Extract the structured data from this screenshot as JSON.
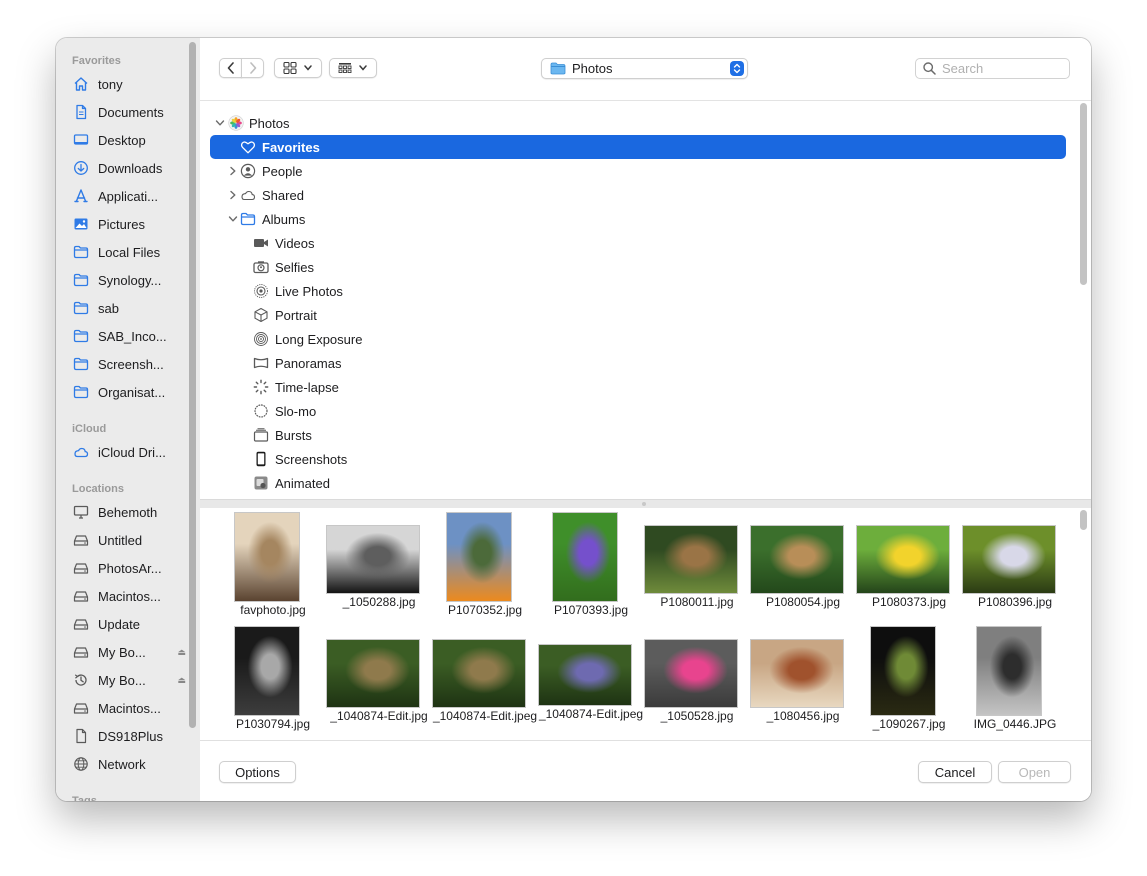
{
  "sidebar": {
    "sections": [
      {
        "title": "Favorites",
        "items": [
          {
            "label": "tony",
            "icon": "home-icon"
          },
          {
            "label": "Documents",
            "icon": "document-icon"
          },
          {
            "label": "Desktop",
            "icon": "desktop-icon"
          },
          {
            "label": "Downloads",
            "icon": "download-icon"
          },
          {
            "label": "Applicati...",
            "icon": "applications-icon"
          },
          {
            "label": "Pictures",
            "icon": "pictures-icon"
          },
          {
            "label": "Local Files",
            "icon": "folder-icon"
          },
          {
            "label": "Synology...",
            "icon": "folder-icon"
          },
          {
            "label": "sab",
            "icon": "folder-icon"
          },
          {
            "label": "SAB_Inco...",
            "icon": "folder-icon"
          },
          {
            "label": "Screensh...",
            "icon": "folder-icon"
          },
          {
            "label": "Organisat...",
            "icon": "folder-icon"
          }
        ]
      },
      {
        "title": "iCloud",
        "items": [
          {
            "label": "iCloud Dri...",
            "icon": "icloud-icon"
          }
        ]
      },
      {
        "title": "Locations",
        "items": [
          {
            "label": "Behemoth",
            "icon": "computer-icon"
          },
          {
            "label": "Untitled",
            "icon": "drive-icon"
          },
          {
            "label": "PhotosAr...",
            "icon": "drive-icon"
          },
          {
            "label": "Macintos...",
            "icon": "drive-icon"
          },
          {
            "label": "Update",
            "icon": "drive-icon"
          },
          {
            "label": "My Bo...",
            "icon": "drive-icon",
            "eject": "⏏"
          },
          {
            "label": "My Bo...",
            "icon": "time-machine-icon",
            "eject": "⏏"
          },
          {
            "label": "Macintos...",
            "icon": "drive-icon"
          },
          {
            "label": "DS918Plus",
            "icon": "server-icon"
          },
          {
            "label": "Network",
            "icon": "network-icon"
          }
        ]
      },
      {
        "title": "Tags",
        "items": []
      }
    ]
  },
  "toolbar": {
    "location": "Photos",
    "search_placeholder": "Search"
  },
  "tree": [
    {
      "label": "Photos",
      "level": 0,
      "disclosure": "open",
      "icon": "photos-app-icon"
    },
    {
      "label": "Favorites",
      "level": 1,
      "disclosure": "none",
      "icon": "heart-icon",
      "selected": true
    },
    {
      "label": "People",
      "level": 1,
      "disclosure": "closed",
      "icon": "person-icon"
    },
    {
      "label": "Shared",
      "level": 1,
      "disclosure": "closed",
      "icon": "cloud-icon"
    },
    {
      "label": "Albums",
      "level": 1,
      "disclosure": "open",
      "icon": "folder-icon"
    },
    {
      "label": "Videos",
      "level": 2,
      "disclosure": "none",
      "icon": "video-icon"
    },
    {
      "label": "Selfies",
      "level": 2,
      "disclosure": "none",
      "icon": "selfie-camera-icon"
    },
    {
      "label": "Live Photos",
      "level": 2,
      "disclosure": "none",
      "icon": "live-photo-icon"
    },
    {
      "label": "Portrait",
      "level": 2,
      "disclosure": "none",
      "icon": "cube-icon"
    },
    {
      "label": "Long Exposure",
      "level": 2,
      "disclosure": "none",
      "icon": "long-exposure-icon"
    },
    {
      "label": "Panoramas",
      "level": 2,
      "disclosure": "none",
      "icon": "panorama-icon"
    },
    {
      "label": "Time-lapse",
      "level": 2,
      "disclosure": "none",
      "icon": "timelapse-icon"
    },
    {
      "label": "Slo-mo",
      "level": 2,
      "disclosure": "none",
      "icon": "slomo-icon"
    },
    {
      "label": "Bursts",
      "level": 2,
      "disclosure": "none",
      "icon": "bursts-icon"
    },
    {
      "label": "Screenshots",
      "level": 2,
      "disclosure": "none",
      "icon": "phone-icon"
    },
    {
      "label": "Animated",
      "level": 2,
      "disclosure": "none",
      "icon": "animated-icon"
    }
  ],
  "photos": [
    {
      "name": "favphoto.jpg",
      "orientation": "portrait",
      "colors": [
        "#e4d4bc",
        "#a58660",
        "#5a4330"
      ]
    },
    {
      "name": "_1050288.jpg",
      "orientation": "landscape",
      "colors": [
        "#d6d6d6",
        "#5e5e5e",
        "#141414"
      ]
    },
    {
      "name": "P1070352.jpg",
      "orientation": "portrait",
      "colors": [
        "#6d91c4",
        "#4c6a3a",
        "#ec8a1e"
      ]
    },
    {
      "name": "P1070393.jpg",
      "orientation": "portrait",
      "colors": [
        "#3f8f2a",
        "#7550cc",
        "#326d1d"
      ]
    },
    {
      "name": "P1080011.jpg",
      "orientation": "landscape",
      "colors": [
        "#2f4a21",
        "#9a7446",
        "#6f8b3b"
      ]
    },
    {
      "name": "P1080054.jpg",
      "orientation": "landscape",
      "colors": [
        "#3b6f2c",
        "#b88e58",
        "#23481b"
      ]
    },
    {
      "name": "P1080373.jpg",
      "orientation": "landscape",
      "colors": [
        "#6dae3c",
        "#f2d32c",
        "#24441a"
      ]
    },
    {
      "name": "P1080396.jpg",
      "orientation": "landscape",
      "colors": [
        "#6d8f2a",
        "#d8d8e8",
        "#2b3b14"
      ]
    },
    {
      "name": "P1030794.jpg",
      "orientation": "portrait",
      "colors": [
        "#1a1a1a",
        "#a8a8a8",
        "#3d3d3d"
      ]
    },
    {
      "name": "_1040874-Edit.jpg",
      "orientation": "landscape",
      "colors": [
        "#3b5d24",
        "#8f7a4c",
        "#1e3313"
      ]
    },
    {
      "name": "_1040874-Edit.jpeg",
      "orientation": "landscape",
      "colors": [
        "#3b5d24",
        "#8f7a4c",
        "#1e3313"
      ]
    },
    {
      "name": "_1040874-Edit.jpeg",
      "orientation": "wide",
      "colors": [
        "#3b5d24",
        "#6e6ab0",
        "#1e3313"
      ]
    },
    {
      "name": "_1050528.jpg",
      "orientation": "landscape",
      "colors": [
        "#5c5c5c",
        "#e8448e",
        "#3b3b3b"
      ]
    },
    {
      "name": "_1080456.jpg",
      "orientation": "landscape",
      "colors": [
        "#c8a684",
        "#a0522d",
        "#e8d8c0"
      ]
    },
    {
      "name": "_1090267.jpg",
      "orientation": "portrait",
      "colors": [
        "#0e0e0e",
        "#6f8a36",
        "#2a2a12"
      ]
    },
    {
      "name": "IMG_0446.JPG",
      "orientation": "portrait",
      "colors": [
        "#7f7f7f",
        "#2d2d2d",
        "#c4c4c4"
      ]
    }
  ],
  "footer": {
    "options_label": "Options",
    "cancel_label": "Cancel",
    "open_label": "Open"
  },
  "colors": {
    "accent": "#1a68e0",
    "sidebar_icon": "#2f7be6",
    "sidebar_bg": "#ebebeb"
  }
}
